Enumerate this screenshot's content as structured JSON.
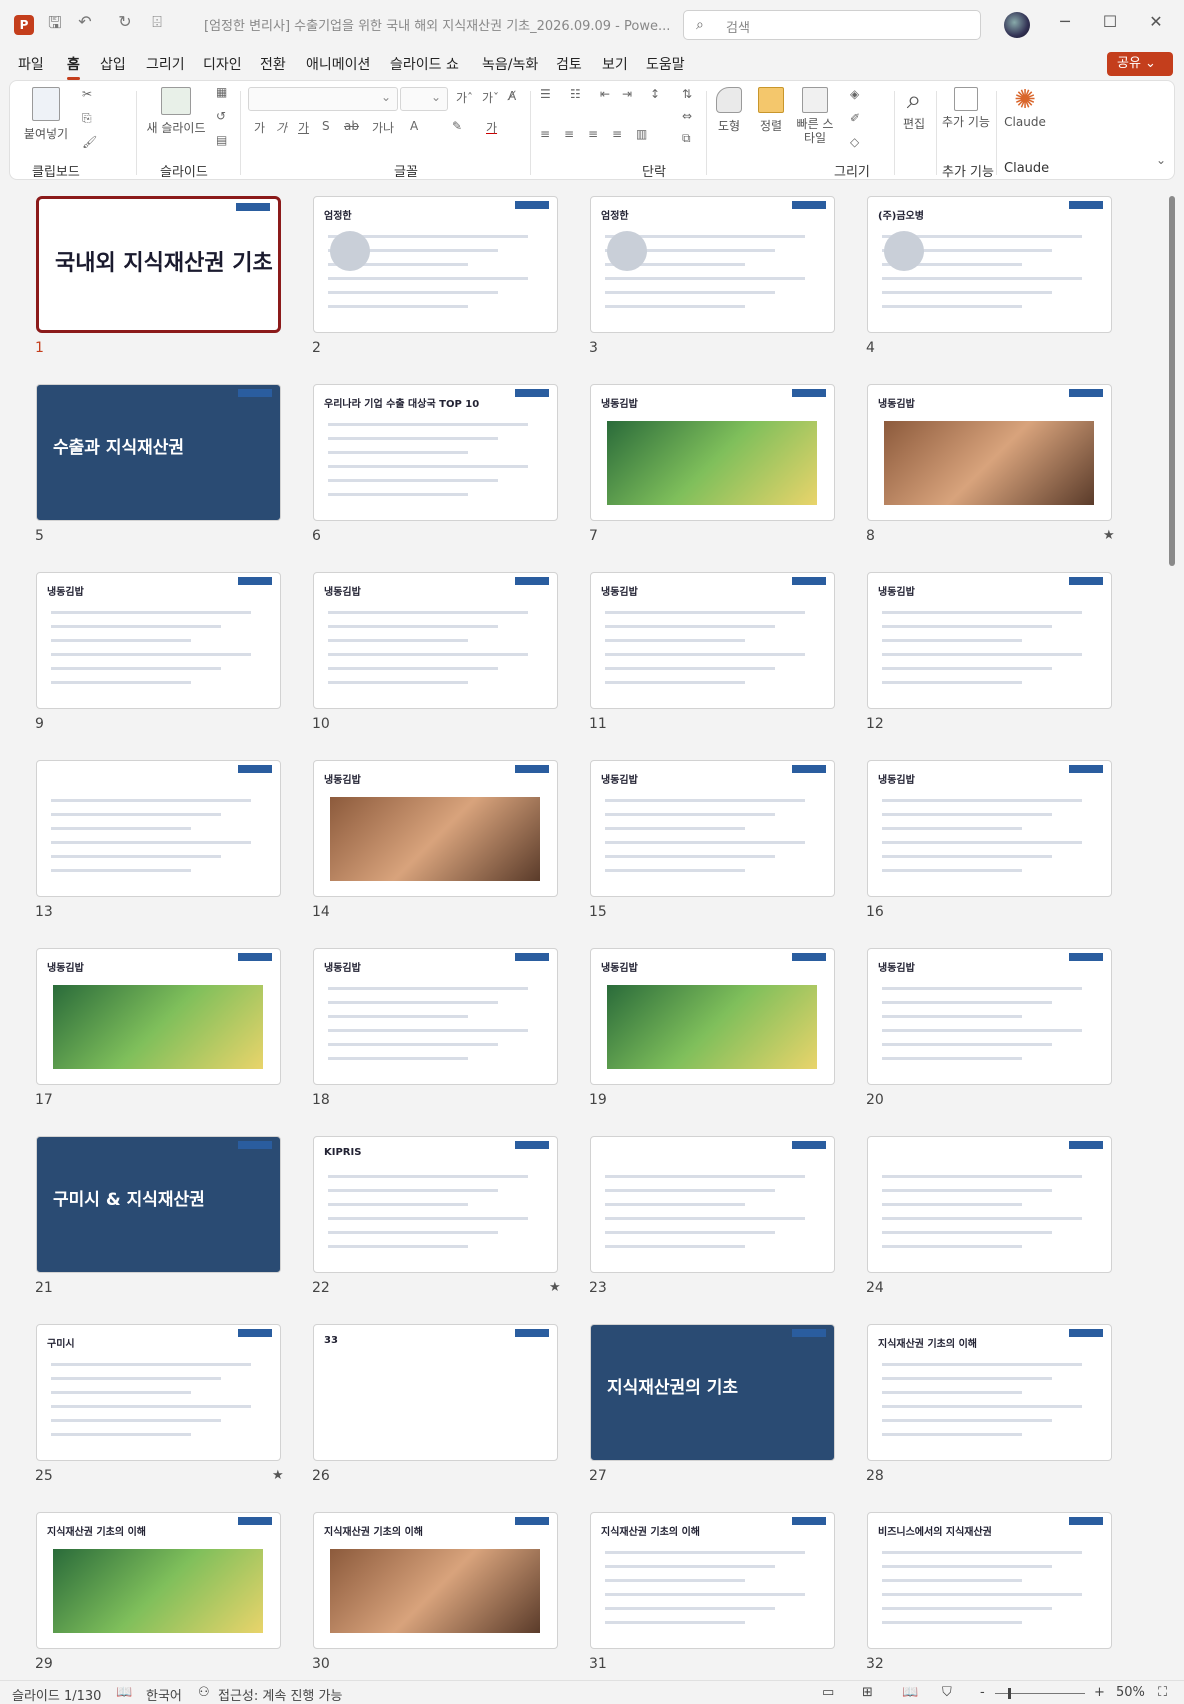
{
  "titlebar": {
    "app_icon": "P",
    "title": "[엄정한 변리사] 수출기업을 위한 국내 해외 지식재산권 기초_2026.09.09  -  Powe...",
    "search_placeholder": "검색",
    "icons": {
      "save": "save-icon",
      "undo": "undo-icon",
      "redo": "redo-icon",
      "customize": "qat-icon"
    },
    "window": {
      "minimize": "─",
      "maximize": "☐",
      "close": "✕"
    }
  },
  "tabs": [
    "파일",
    "홈",
    "삽입",
    "그리기",
    "디자인",
    "전환",
    "애니메이션",
    "슬라이드 쇼",
    "녹음/녹화",
    "검토",
    "보기",
    "도움말"
  ],
  "active_tab": "홈",
  "share_label": "공유",
  "ribbon": {
    "paste_label": "붙여넣기",
    "new_slide_label": "새 슬라이드",
    "shape_label": "도형",
    "arrange_label": "정렬",
    "quick_styles_label": "빠른 스타일",
    "edit_label": "편집",
    "addins_label": "추가 기능",
    "claude_label": "Claude",
    "groups": [
      "클립보드",
      "슬라이드",
      "글꼴",
      "단락",
      "그리기",
      "추가 기능",
      "Claude"
    ],
    "font_buttons": [
      "가",
      "가",
      "가",
      "S",
      "ab",
      "가나",
      "A",
      "가"
    ]
  },
  "slides": [
    {
      "n": "1",
      "title": "국내외 지식재산권 기초",
      "kind": "title",
      "selected": true
    },
    {
      "n": "2",
      "title": "엄정한",
      "kind": "profile"
    },
    {
      "n": "3",
      "title": "엄정한",
      "kind": "profile"
    },
    {
      "n": "4",
      "title": "(주)금오병",
      "kind": "profile"
    },
    {
      "n": "5",
      "title": "수출과 지식재산권",
      "kind": "dark"
    },
    {
      "n": "6",
      "title": "우리나라 기업 수출 대상국 TOP 10",
      "kind": "list"
    },
    {
      "n": "7",
      "title": "냉동김밥",
      "kind": "photo"
    },
    {
      "n": "8",
      "title": "냉동김밥",
      "kind": "photo",
      "star": true
    },
    {
      "n": "9",
      "title": "냉동김밥",
      "kind": "doc"
    },
    {
      "n": "10",
      "title": "냉동김밥",
      "kind": "doc"
    },
    {
      "n": "11",
      "title": "냉동김밥",
      "kind": "doc"
    },
    {
      "n": "12",
      "title": "냉동김밥",
      "kind": "doc"
    },
    {
      "n": "13",
      "title": "",
      "kind": "doc"
    },
    {
      "n": "14",
      "title": "냉동김밥",
      "kind": "photo"
    },
    {
      "n": "15",
      "title": "냉동김밥",
      "kind": "doc"
    },
    {
      "n": "16",
      "title": "냉동김밥",
      "kind": "doc"
    },
    {
      "n": "17",
      "title": "냉동김밥",
      "kind": "photo"
    },
    {
      "n": "18",
      "title": "냉동김밥",
      "kind": "doc"
    },
    {
      "n": "19",
      "title": "냉동김밥",
      "kind": "photo"
    },
    {
      "n": "20",
      "title": "냉동김밥",
      "kind": "doc"
    },
    {
      "n": "21",
      "title": "구미시 & 지식재산권",
      "kind": "dark"
    },
    {
      "n": "22",
      "title": "KIPRIS",
      "kind": "doc",
      "star": true
    },
    {
      "n": "23",
      "title": "",
      "kind": "doc"
    },
    {
      "n": "24",
      "title": "",
      "kind": "doc"
    },
    {
      "n": "25",
      "title": "구미시",
      "kind": "doc",
      "star": true
    },
    {
      "n": "26",
      "title": "33",
      "kind": "blank"
    },
    {
      "n": "27",
      "title": "지식재산권의 기초",
      "kind": "dark"
    },
    {
      "n": "28",
      "title": "지식재산권 기초의 이해",
      "kind": "doc"
    },
    {
      "n": "29",
      "title": "지식재산권 기초의 이해",
      "kind": "photo"
    },
    {
      "n": "30",
      "title": "지식재산권 기초의 이해",
      "kind": "photo"
    },
    {
      "n": "31",
      "title": "지식재산권 기초의 이해",
      "kind": "doc"
    },
    {
      "n": "32",
      "title": "비즈니스에서의 지식재산권",
      "kind": "doc"
    }
  ],
  "status": {
    "slide_count": "슬라이드 1/130",
    "language": "한국어",
    "accessibility": "접근성: 계속 진행 가능",
    "zoom": "50%",
    "zoom_minus": "-",
    "zoom_plus": "+"
  }
}
